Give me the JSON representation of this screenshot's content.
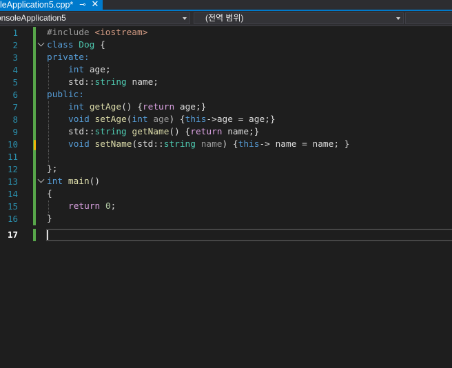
{
  "tab": {
    "title": "oleApplication5.cpp*",
    "pin_glyph": "⊸",
    "close_glyph": "✕"
  },
  "navbar": {
    "project": "onsoleApplication5",
    "scope": "(전역 범위)"
  },
  "editor": {
    "line_numbers": [
      "1",
      "2",
      "3",
      "4",
      "5",
      "6",
      "7",
      "8",
      "9",
      "10",
      "11",
      "12",
      "13",
      "14",
      "15",
      "16",
      "17"
    ],
    "current_line": "17",
    "tokens": {
      "include_directive": "#include",
      "include_header": "<iostream>",
      "kw_class": "class",
      "class_name": "Dog",
      "open_brace": "{",
      "access_private": "private:",
      "kw_int": "int",
      "field_age": "age;",
      "std_prefix": "std::",
      "type_string": "string",
      "field_name": "name;",
      "access_public": "public:",
      "fn_getAge": "getAge",
      "parens": "()",
      "ret_age_open": " {",
      "kw_return": "return",
      "ret_age_tail": " age;}",
      "kw_void": "void",
      "fn_setAge": "setAge",
      "param_age": "age",
      "kw_this": "this",
      "setAge_body": "->age = age;}",
      "fn_getName": "getName",
      "ret_name_tail": " name;}",
      "fn_setName": "setName",
      "param_name": "name",
      "setName_body": "-> name = name; }",
      "close_class": "};",
      "fn_main": "main",
      "open_main": "{",
      "return_zero_value": "0",
      "semicolon": ";",
      "close_main": "}"
    }
  },
  "colors": {
    "keyword": "#569cd6",
    "type": "#4ec9b0",
    "function": "#dcdcaa",
    "line_number": "#2b91af",
    "saved_change_bar": "#57a64a",
    "unsaved_change_bar": "#efb508",
    "tab_accent": "#007acc"
  }
}
